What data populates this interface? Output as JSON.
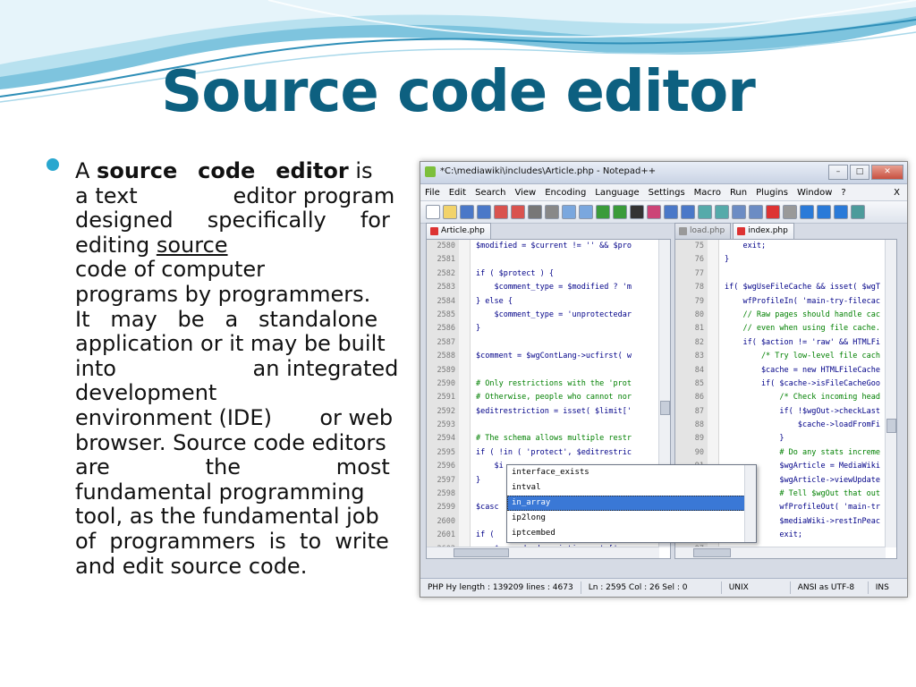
{
  "slide": {
    "title": "Source code editor",
    "bullet": {
      "lines": [
        [
          {
            "t": "A "
          },
          {
            "t": "source",
            "b": true
          },
          {
            "t": "   "
          },
          {
            "t": "code",
            "b": true
          },
          {
            "t": "   "
          },
          {
            "t": "editor",
            "b": true
          },
          {
            "t": " is"
          }
        ],
        [
          {
            "t": "a text              editor program"
          }
        ],
        [
          {
            "t": "designed     specifically     for"
          }
        ],
        [
          {
            "t": "editing "
          },
          {
            "t": "source",
            "u": true
          }
        ],
        [
          {
            "t": "code of computer"
          }
        ],
        [
          {
            "t": "programs by programmers."
          }
        ],
        [
          {
            "t": "It   may   be   a   standalone"
          }
        ],
        [
          {
            "t": "application or it may be built"
          }
        ],
        [
          {
            "t": "into                    an integrated"
          }
        ],
        [
          {
            "t": "development"
          }
        ],
        [
          {
            "t": "environment (IDE)       or web"
          }
        ],
        [
          {
            "t": "browser. Source code editors"
          }
        ],
        [
          {
            "t": "are              the              most"
          }
        ],
        [
          {
            "t": "fundamental programming"
          }
        ],
        [
          {
            "t": "tool, as the fundamental job"
          }
        ],
        [
          {
            "t": "of  programmers  is  to  write"
          }
        ],
        [
          {
            "t": "and edit source code."
          }
        ]
      ]
    }
  },
  "editor": {
    "window_title": "*C:\\mediawiki\\includes\\Article.php - Notepad++",
    "window_buttons": {
      "minimize": "–",
      "maximize": "□",
      "close": "✕"
    },
    "menu": [
      "File",
      "Edit",
      "Search",
      "View",
      "Encoding",
      "Language",
      "Settings",
      "Macro",
      "Run",
      "Plugins",
      "Window",
      "?"
    ],
    "menu_close": "X",
    "toolbar_icons": [
      "new-icon",
      "open-icon",
      "save-icon",
      "save-all-icon",
      "close-icon",
      "close-all-icon",
      "print-icon",
      "cut-icon",
      "copy-icon",
      "paste-icon",
      "undo-icon",
      "redo-icon",
      "find-icon",
      "replace-icon",
      "zoom-in-icon",
      "zoom-out-icon",
      "sync-v-icon",
      "sync-h-icon",
      "wrap-icon",
      "indent-guide-icon",
      "record-icon",
      "stop-icon",
      "play-icon",
      "play-multi-icon",
      "save-macro-icon",
      "trim-icon"
    ],
    "left_tabs": [
      {
        "label": "Article.php",
        "active": true
      }
    ],
    "right_tabs": [
      {
        "label": "load.php",
        "active": false
      },
      {
        "label": "index.php",
        "active": true
      }
    ],
    "left_lines": [
      {
        "n": "2580",
        "code": "$modified = $current != '' && $pro"
      },
      {
        "n": "2581",
        "code": ""
      },
      {
        "n": "2582",
        "code": "if ( $protect ) {"
      },
      {
        "n": "2583",
        "code": "    $comment_type = $modified ? 'm"
      },
      {
        "n": "2584",
        "code": "} else {"
      },
      {
        "n": "2585",
        "code": "    $comment_type = 'unprotectedar"
      },
      {
        "n": "2586",
        "code": "}"
      },
      {
        "n": "2587",
        "code": ""
      },
      {
        "n": "2588",
        "code": "$comment = $wgContLang->ucfirst( w"
      },
      {
        "n": "2589",
        "code": ""
      },
      {
        "n": "2590",
        "code": "# Only restrictions with the 'prot"
      },
      {
        "n": "2591",
        "code": "# Otherwise, people who cannot nor"
      },
      {
        "n": "2592",
        "code": "$editrestriction = isset( $limit['"
      },
      {
        "n": "2593",
        "code": ""
      },
      {
        "n": "2594",
        "code": "# The schema allows multiple restr"
      },
      {
        "n": "2595",
        "code": "if ( !in ( 'protect', $editrestric"
      },
      {
        "n": "2596",
        "code": "    $i"
      },
      {
        "n": "2597",
        "code": "}"
      },
      {
        "n": "2598",
        "code": ""
      },
      {
        "n": "2599",
        "code": "$casc"
      },
      {
        "n": "2600",
        "code": ""
      },
      {
        "n": "2601",
        "code": "if ( "
      },
      {
        "n": "2602",
        "code": "    $cascade_description = ' ['"
      }
    ],
    "right_lines": [
      {
        "n": "75",
        "code": "    exit;"
      },
      {
        "n": "76",
        "code": "}"
      },
      {
        "n": "77",
        "code": ""
      },
      {
        "n": "78",
        "code": "if( $wgUseFileCache && isset( $wgT"
      },
      {
        "n": "79",
        "code": "    wfProfileIn( 'main-try-filecac"
      },
      {
        "n": "80",
        "code": "    // Raw pages should handle cac"
      },
      {
        "n": "81",
        "code": "    // even when using file cache."
      },
      {
        "n": "82",
        "code": "    if( $action != 'raw' && HTMLFi"
      },
      {
        "n": "83",
        "code": "        /* Try low-level file cach"
      },
      {
        "n": "84",
        "code": "        $cache = new HTMLFileCache"
      },
      {
        "n": "85",
        "code": "        if( $cache->isFileCacheGoo"
      },
      {
        "n": "86",
        "code": "            /* Check incoming head"
      },
      {
        "n": "87",
        "code": "            if( !$wgOut->checkLast"
      },
      {
        "n": "88",
        "code": "                $cache->loadFromFi"
      },
      {
        "n": "89",
        "code": "            }"
      },
      {
        "n": "90",
        "code": "            # Do any stats increme"
      },
      {
        "n": "91",
        "code": "            $wgArticle = MediaWiki"
      },
      {
        "n": "92",
        "code": "            $wgArticle->viewUpdate"
      },
      {
        "n": "93",
        "code": "            # Tell $wgOut that out"
      },
      {
        "n": "94",
        "code": "            wfProfileOut( 'main-tr"
      },
      {
        "n": "95",
        "code": "            $mediaWiki->restInPeac"
      },
      {
        "n": "96",
        "code": "            exit;"
      },
      {
        "n": "97",
        "code": ""
      }
    ],
    "scroll_arrow_up": "▲",
    "scroll_arrow_down": "▼",
    "hscroll_grip": "III",
    "autocomplete": {
      "items": [
        "interface_exists",
        "intval",
        "in_array",
        "ip2long",
        "iptcembed"
      ],
      "selected": 2
    },
    "status": [
      "PHP Hy length : 139209    lines : 4673",
      "Ln : 2595    Col : 26    Sel : 0",
      "UNIX",
      "ANSI as UTF-8",
      "INS"
    ]
  },
  "colors": {
    "title": "#0d6080",
    "bullet": "#29a7cf",
    "wave_dark": "#2f8fb8",
    "wave_light": "#a9d8ea",
    "selection": "#3a78d6"
  }
}
